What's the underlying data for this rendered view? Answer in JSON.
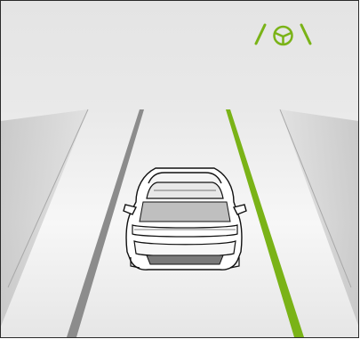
{
  "indicator": {
    "icon": "lane-keeping-assist-icon",
    "status": "active",
    "color": "#7ab317"
  },
  "scene": {
    "sky_color": "#e6e6e6",
    "road_color": "#f1f1f1",
    "lane_line_color": "#8c8c8c",
    "active_lane_color": "#7ab317",
    "vehicle": "car-rear-view-icon"
  }
}
